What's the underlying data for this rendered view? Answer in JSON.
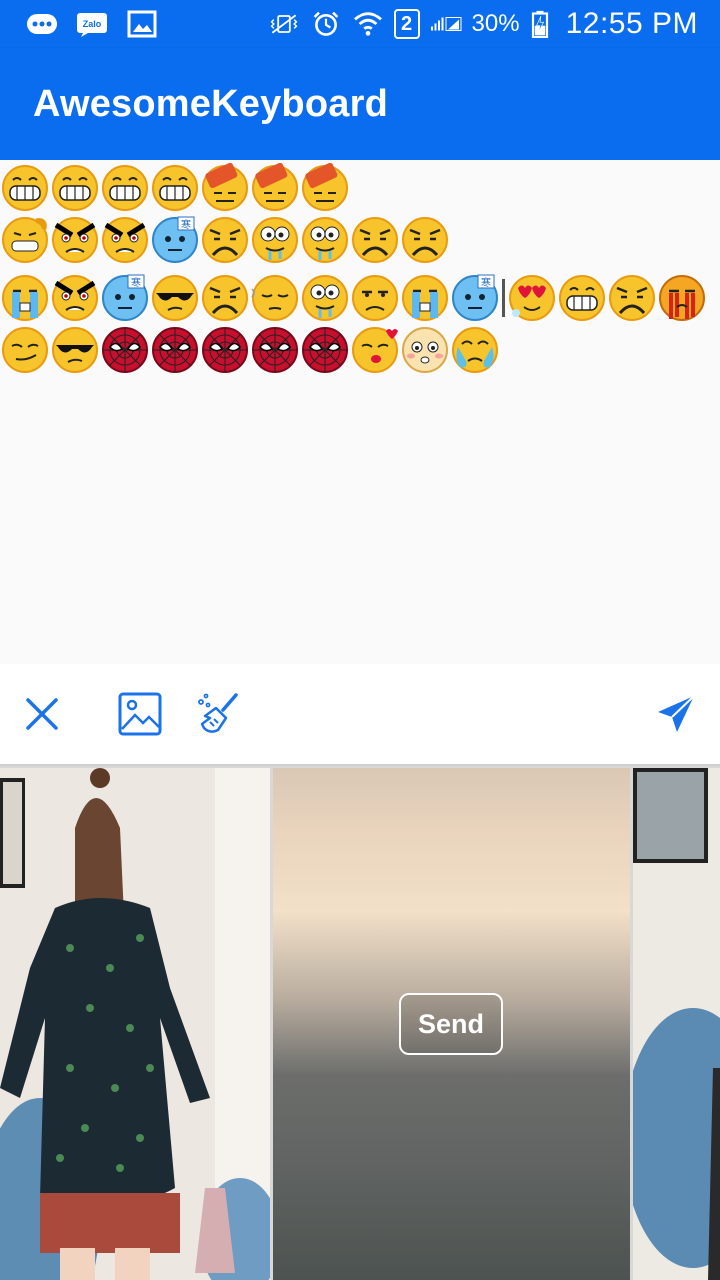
{
  "status_bar": {
    "icons_left": [
      "chat-bubble-icon",
      "zalo-icon",
      "image-icon"
    ],
    "icons_right": [
      "vibrate-icon",
      "alarm-icon",
      "wifi-icon",
      "signal-icon",
      "battery-charging-icon"
    ],
    "sim": "2",
    "battery": "30%",
    "time": "12:55 PM",
    "bg_color": "#0a6df0"
  },
  "app_bar": {
    "title": "AwesomeKeyboard",
    "color": "#0a6df0"
  },
  "compose": {
    "lines": [
      [
        "grin",
        "grin",
        "grin",
        "grin",
        "brick",
        "brick",
        "brick"
      ],
      [
        "flex",
        "angry",
        "angry",
        "freeze",
        "frown",
        "drool",
        "drool",
        "frown",
        "frown"
      ],
      [
        "cry",
        "angry",
        "freeze",
        "cool",
        "frown",
        "sleepy",
        "drool",
        "annoyed",
        "cry",
        "freeze",
        "caret",
        "love",
        "grin",
        "frown",
        "bleed"
      ],
      [
        "smirk",
        "cool",
        "spider",
        "spider",
        "spider",
        "spider",
        "spider",
        "kiss",
        "shy",
        "tear"
      ]
    ]
  },
  "toolbar": {
    "close_icon": "close-icon",
    "image_icon": "image-icon",
    "clear_icon": "broom-icon",
    "send_icon": "send-icon",
    "accent": "#1a73e8"
  },
  "gallery": {
    "send_label": "Send"
  }
}
